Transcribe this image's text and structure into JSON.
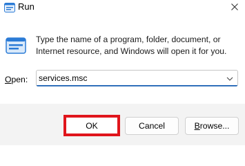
{
  "window": {
    "title": "Run",
    "close_glyph": "✕",
    "icon": "run-app-icon"
  },
  "body": {
    "description": "Type the name of a program, folder, document, or Internet resource, and Windows will open it for you.",
    "icon": "run-app-icon"
  },
  "open": {
    "label_accel": "O",
    "label_rest": "pen:",
    "value": "services.msc",
    "dropdown_icon": "chevron-down-icon"
  },
  "buttons": {
    "ok": "OK",
    "cancel": "Cancel",
    "browse_accel": "B",
    "browse_rest": "rowse..."
  },
  "colors": {
    "highlight": "#e0151c",
    "focus_accent": "#2f6fba",
    "icon_blue": "#2b7bd6"
  }
}
